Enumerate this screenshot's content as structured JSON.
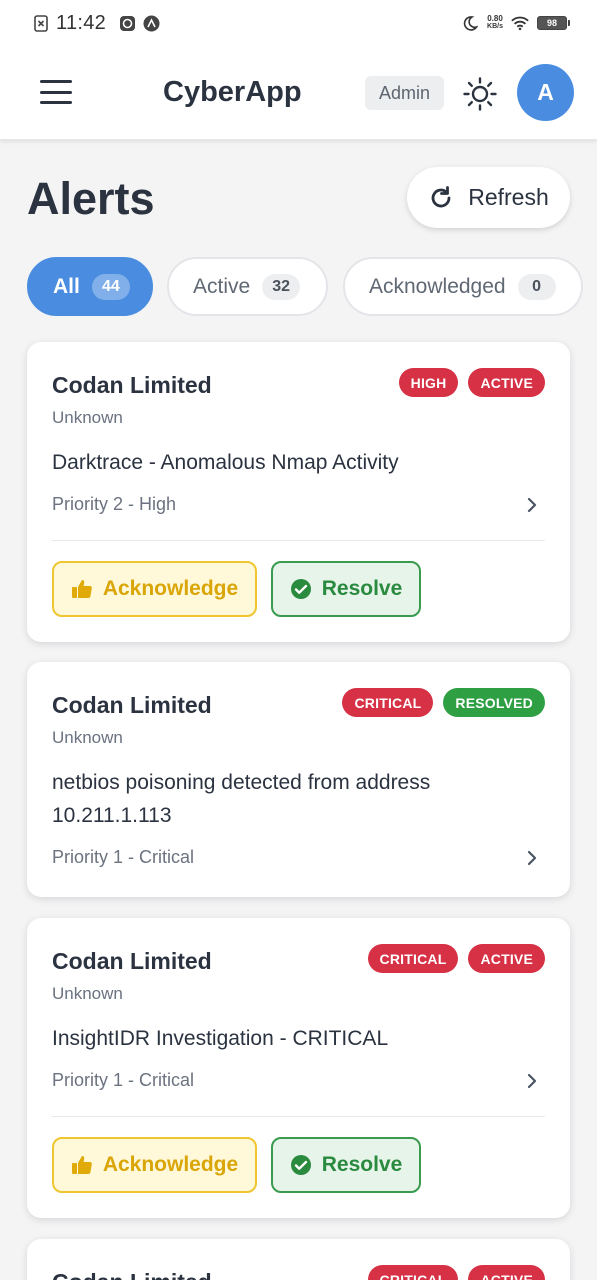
{
  "status_bar": {
    "time": "11:42",
    "network_speed_value": "0.80",
    "network_speed_unit": "KB/s",
    "battery": "98"
  },
  "app_bar": {
    "title": "CyberApp",
    "role": "Admin",
    "avatar_initial": "A"
  },
  "page": {
    "title": "Alerts",
    "refresh_label": "Refresh"
  },
  "filters": [
    {
      "label": "All",
      "count": "44",
      "selected": true
    },
    {
      "label": "Active",
      "count": "32",
      "selected": false
    },
    {
      "label": "Acknowledged",
      "count": "0",
      "selected": false
    }
  ],
  "alerts": [
    {
      "company": "Codan Limited",
      "source": "Unknown",
      "description": "Darktrace - Anomalous Nmap Activity",
      "priority": "Priority 2 - High",
      "severity": "HIGH",
      "status": "ACTIVE",
      "actions": {
        "acknowledge": "Acknowledge",
        "resolve": "Resolve"
      }
    },
    {
      "company": "Codan Limited",
      "source": "Unknown",
      "description": "netbios poisoning detected from address 10.211.1.113",
      "priority": "Priority 1 - Critical",
      "severity": "CRITICAL",
      "status": "RESOLVED"
    },
    {
      "company": "Codan Limited",
      "source": "Unknown",
      "description": "InsightIDR Investigation - CRITICAL",
      "priority": "Priority 1 - Critical",
      "severity": "CRITICAL",
      "status": "ACTIVE",
      "actions": {
        "acknowledge": "Acknowledge",
        "resolve": "Resolve"
      }
    },
    {
      "company": "Codan Limited",
      "severity": "CRITICAL",
      "status": "ACTIVE"
    }
  ],
  "colors": {
    "accent": "#4a8de0",
    "badge_red": "#d63145",
    "badge_green": "#2ea043",
    "acknowledge": "#f0c630",
    "resolve": "#3a9b4f"
  },
  "icons": [
    "menu-icon",
    "sun-icon",
    "refresh-icon",
    "thumbs-up-icon",
    "check-circle-icon",
    "chevron-right-icon",
    "wifi-icon",
    "moon-icon"
  ]
}
